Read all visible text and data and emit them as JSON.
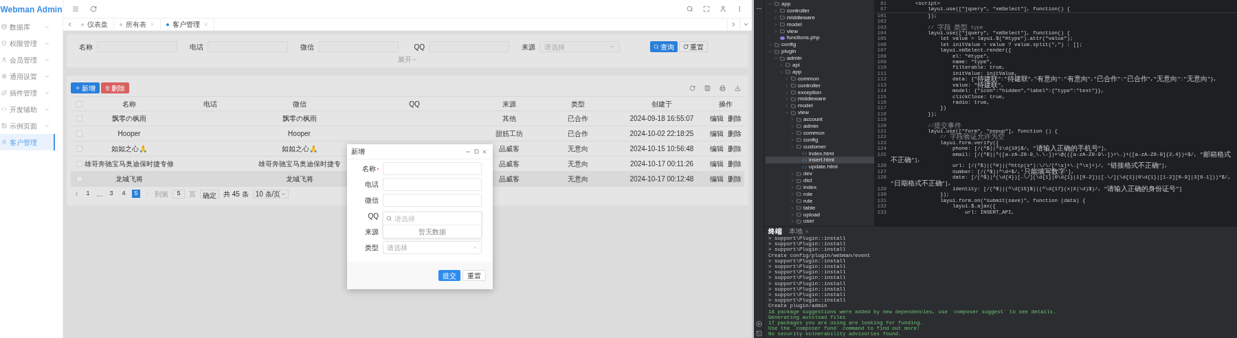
{
  "app": {
    "title": "Webman Admin"
  },
  "sidebar": {
    "items": [
      {
        "label": "数据库",
        "kind": "group",
        "selected": false
      },
      {
        "label": "权限管理",
        "kind": "group",
        "selected": false
      },
      {
        "label": "会员管理",
        "kind": "group",
        "selected": false
      },
      {
        "label": "通用设置",
        "kind": "group",
        "selected": false
      },
      {
        "label": "插件管理",
        "kind": "group",
        "selected": false
      },
      {
        "label": "开发辅助",
        "kind": "group",
        "selected": false
      },
      {
        "label": "示例页面",
        "kind": "group",
        "selected": false
      },
      {
        "label": "客户管理",
        "kind": "link",
        "selected": true
      }
    ]
  },
  "tabs": [
    {
      "label": "仪表盘",
      "selected": false,
      "closable": false
    },
    {
      "label": "所有表",
      "selected": false,
      "closable": true
    },
    {
      "label": "客户管理",
      "selected": true,
      "closable": true
    }
  ],
  "search_form": {
    "fields": [
      {
        "label": "名称",
        "kind": "input"
      },
      {
        "label": "电话",
        "kind": "input"
      },
      {
        "label": "微信",
        "kind": "input"
      },
      {
        "label": "QQ",
        "kind": "input"
      },
      {
        "label": "来源",
        "kind": "select",
        "placeholder": "请选择"
      }
    ],
    "buttons": [
      {
        "label": "查询",
        "kind": "primary"
      },
      {
        "label": "重置",
        "kind": "default"
      }
    ],
    "expand_link": "展开"
  },
  "toolbar": {
    "buttons": [
      {
        "label": "新增",
        "kind": "primary"
      },
      {
        "label": "删除",
        "kind": "danger"
      }
    ]
  },
  "table": {
    "all_checked": false,
    "columns": [
      "名称",
      "电话",
      "微信",
      "QQ",
      "来源",
      "类型",
      "创建于",
      "操作"
    ],
    "rows": [
      {
        "name": "飘零の枫雨",
        "wechat": "飘零の枫雨",
        "source": "其他",
        "type": "已合作",
        "created_at": "2024-09-18 16:55:07",
        "actions": [
          "编辑",
          "删除"
        ],
        "checked": false,
        "hovered": false
      },
      {
        "name": "Hooper",
        "wechat": "Hooper",
        "source": "甜筋工坊",
        "type": "已合作",
        "created_at": "2024-10-02 22:18:25",
        "actions": [
          "编辑",
          "删除"
        ],
        "checked": false,
        "hovered": false
      },
      {
        "name": "如如之心🙏",
        "wechat": "如如之心🙏",
        "source": "品威客",
        "type": "无意向",
        "created_at": "2024-10-15 10:56:48",
        "actions": [
          "编辑",
          "删除"
        ],
        "checked": false,
        "hovered": false
      },
      {
        "name": "雄哥奔驰宝马奥迪保时捷专修",
        "wechat": "雄哥奔驰宝马奥迪保时捷专",
        "source": "品威客",
        "type": "无意向",
        "created_at": "2024-10-17 00:11:26",
        "actions": [
          "编辑",
          "删除"
        ],
        "checked": false,
        "hovered": false
      },
      {
        "name": "龙城飞将",
        "wechat": "龙城飞将",
        "source": "品威客",
        "type": "无意向",
        "created_at": "2024-10-17 00:12:48",
        "actions": [
          "编辑",
          "删除"
        ],
        "checked": false,
        "hovered": true
      }
    ]
  },
  "pagination": {
    "pages": [
      {
        "label": "1",
        "kind": "page",
        "selected": false
      },
      {
        "label": "…",
        "kind": "ellipsis",
        "selected": false
      },
      {
        "label": "3",
        "kind": "page",
        "selected": false
      },
      {
        "label": "4",
        "kind": "page",
        "selected": false
      },
      {
        "label": "5",
        "kind": "page",
        "selected": true
      }
    ],
    "next_disabled": true,
    "goto_label": "到第",
    "goto_value": "5",
    "page_unit": "页",
    "confirm": "确定",
    "total": "共 45 条",
    "page_size": "10 条/页"
  },
  "dialog": {
    "title": "新增",
    "fields": [
      {
        "label": "名称",
        "kind": "input",
        "required": true
      },
      {
        "label": "电话",
        "kind": "input",
        "required": false
      },
      {
        "label": "微信",
        "kind": "input",
        "required": false
      },
      {
        "label": "QQ",
        "kind": "covered",
        "required": false
      },
      {
        "label": "来源",
        "kind": "covered",
        "required": false
      },
      {
        "label": "类型",
        "kind": "select",
        "required": false,
        "placeholder": "请选择",
        "expanded": true,
        "dropdown": {
          "search_placeholder": "请选择",
          "empty_text": "暂无数据"
        }
      }
    ],
    "buttons": [
      {
        "label": "提交",
        "kind": "primary"
      },
      {
        "label": "重置",
        "kind": "default"
      }
    ]
  },
  "ide": {
    "file_tree": [
      {
        "name": "app",
        "kind": "folder",
        "expanded": true,
        "selected": false,
        "children": [
          {
            "name": "controller",
            "kind": "folder",
            "expanded": false,
            "selected": false
          },
          {
            "name": "middleware",
            "kind": "folder",
            "expanded": false,
            "selected": false
          },
          {
            "name": "model",
            "kind": "folder",
            "expanded": false,
            "selected": false
          },
          {
            "name": "view",
            "kind": "folder",
            "expanded": false,
            "selected": false
          },
          {
            "name": "functions.php",
            "kind": "php",
            "selected": false
          }
        ]
      },
      {
        "name": "config",
        "kind": "folder",
        "expanded": false,
        "selected": false
      },
      {
        "name": "plugin",
        "kind": "folder",
        "expanded": true,
        "selected": false,
        "children": [
          {
            "name": "admin",
            "kind": "folder",
            "expanded": true,
            "selected": false,
            "children": [
              {
                "name": "api",
                "kind": "folder",
                "expanded": false,
                "selected": false
              },
              {
                "name": "app",
                "kind": "folder",
                "expanded": true,
                "selected": false,
                "children": [
                  {
                    "name": "common",
                    "kind": "folder",
                    "expanded": false,
                    "selected": false
                  },
                  {
                    "name": "controller",
                    "kind": "folder",
                    "expanded": false,
                    "selected": false
                  },
                  {
                    "name": "exception",
                    "kind": "folder",
                    "expanded": false,
                    "selected": false
                  },
                  {
                    "name": "middleware",
                    "kind": "folder",
                    "expanded": false,
                    "selected": false
                  },
                  {
                    "name": "model",
                    "kind": "folder",
                    "expanded": false,
                    "selected": false
                  },
                  {
                    "name": "view",
                    "kind": "folder",
                    "expanded": true,
                    "selected": false,
                    "children": [
                      {
                        "name": "account",
                        "kind": "folder",
                        "expanded": false,
                        "selected": false
                      },
                      {
                        "name": "admin",
                        "kind": "folder",
                        "expanded": false,
                        "selected": false
                      },
                      {
                        "name": "common",
                        "kind": "folder",
                        "expanded": false,
                        "selected": false
                      },
                      {
                        "name": "config",
                        "kind": "folder",
                        "expanded": false,
                        "selected": false
                      },
                      {
                        "name": "customer",
                        "kind": "folder",
                        "expanded": true,
                        "selected": false,
                        "children": [
                          {
                            "name": "index.html",
                            "kind": "html",
                            "selected": false
                          },
                          {
                            "name": "insert.html",
                            "kind": "html",
                            "selected": true
                          },
                          {
                            "name": "update.html",
                            "kind": "html",
                            "selected": false
                          }
                        ]
                      },
                      {
                        "name": "dev",
                        "kind": "folder",
                        "expanded": false,
                        "selected": false
                      },
                      {
                        "name": "dict",
                        "kind": "folder",
                        "expanded": false,
                        "selected": false
                      },
                      {
                        "name": "index",
                        "kind": "folder",
                        "expanded": false,
                        "selected": false
                      },
                      {
                        "name": "role",
                        "kind": "folder",
                        "expanded": false,
                        "selected": false
                      },
                      {
                        "name": "rule",
                        "kind": "folder",
                        "expanded": false,
                        "selected": false
                      },
                      {
                        "name": "table",
                        "kind": "folder",
                        "expanded": false,
                        "selected": false
                      },
                      {
                        "name": "upload",
                        "kind": "folder",
                        "expanded": false,
                        "selected": false
                      },
                      {
                        "name": "user",
                        "kind": "folder",
                        "expanded": false,
                        "selected": false
                      }
                    ]
                  }
                ]
              }
            ]
          }
        ]
      }
    ],
    "editor": {
      "sticky_lines": [
        {
          "number": "81",
          "text": "        <script>",
          "kind": "code"
        },
        {
          "number": "87",
          "text": "            layui.use([\"jquery\", \"xmSelect\"], function() {",
          "kind": "code"
        }
      ],
      "lines": [
        {
          "number": "101",
          "text": "            });",
          "kind": "code"
        },
        {
          "number": "102"
        },
        {
          "number": "103",
          "text": "            // 字段 类型 type",
          "kind": "comment"
        },
        {
          "number": "104",
          "text": "            layui.use([\"jquery\", \"xmSelect\"], function() {",
          "kind": "code"
        },
        {
          "number": "105",
          "text": "                let value = layui.$(\"#type\").attr(\"value\");",
          "kind": "code"
        },
        {
          "number": "106",
          "text": "                let initValue = value ? value.split(\",\") : [];",
          "kind": "code"
        },
        {
          "number": "107",
          "text": "                layui.xmSelect.render({",
          "kind": "code"
        },
        {
          "number": "108",
          "text": "                    el: \"#type\",",
          "kind": "code"
        },
        {
          "number": "109",
          "text": "                    name: \"type\",",
          "kind": "code"
        },
        {
          "number": "110",
          "text": "                    filterable: true,",
          "kind": "code"
        },
        {
          "number": "111",
          "text": "                    initValue: initValue,",
          "kind": "code"
        },
        {
          "number": "112",
          "text": "                    data: {\"待建联\":\"待建联\",\"有意向\":\"有意向\",\"已合作\":\"已合作\",\"无意向\":\"无意向\"},",
          "kind": "code"
        },
        {
          "number": "113",
          "text": "                    value: \"待建联\",",
          "kind": "code"
        },
        {
          "number": "114",
          "text": "                    model: {\"icon\":\"hidden\",\"label\":{\"type\":\"text\"}},",
          "kind": "code"
        },
        {
          "number": "115",
          "text": "                    clickClose: true,",
          "kind": "code"
        },
        {
          "number": "116",
          "text": "                    radio: true,",
          "kind": "code"
        },
        {
          "number": "117",
          "text": "                })",
          "kind": "code"
        },
        {
          "number": "118",
          "text": "            });",
          "kind": "code"
        },
        {
          "number": "119"
        },
        {
          "number": "120",
          "text": "            //提交事件",
          "kind": "comment"
        },
        {
          "number": "121",
          "text": "            layui.use([\"form\", \"popup\"], function () {",
          "kind": "code"
        },
        {
          "number": "122",
          "text": "                // 字段验证允许为空",
          "kind": "comment"
        },
        {
          "number": "123",
          "text": "                layui.form.verify({",
          "kind": "code"
        },
        {
          "number": "124",
          "text": "                    phone: [/(^$)|^1\\d{10}$/, \"请输入正确的手机号\"],",
          "kind": "code"
        },
        {
          "number": "125",
          "text": "                    email: [/(^$)|^([a-zA-Z0-9_\\.\\-])+\\@(([a-zA-Z0-9\\-])+\\.)+([a-zA-Z0-9]{2,4})+$/, \"邮箱格式不正确\"],",
          "kind": "code"
        },
        {
          "number": "126",
          "text": "                    url: [/(^$)|(^#)|(^http(s*):\\/\\/[^\\s]+\\.[^\\s]+)/, \"链接格式不正确\"],",
          "kind": "code"
        },
        {
          "number": "127",
          "text": "                    number: [/(^$)|^\\d+$/,'只能填写数字'],",
          "kind": "code"
        },
        {
          "number": "128",
          "text": "                    date: [/(^$)|^(\\d{4})[-\\/](\\d{1}|0\\d{1}|1[0-2])([-\\/](\\d{1}|0\\d{1}|[1-2][0-9]|3[0-1]))*$/, \"日期格式不正确\"],",
          "kind": "code"
        },
        {
          "number": "129",
          "text": "                    identity: [/(^$)|(^\\d{15}$)|(^\\d{17}(x|X|\\d)$)/, \"请输入正确的身份证号\"]",
          "kind": "code"
        },
        {
          "number": "130",
          "text": "                });",
          "kind": "code"
        },
        {
          "number": "131",
          "text": "                layui.form.on(\"submit(save)\", function (data) {",
          "kind": "code"
        },
        {
          "number": "132",
          "text": "                    layui.$.ajax({",
          "kind": "code"
        },
        {
          "number": "133",
          "text": "                        url: INSERT_API,",
          "kind": "code"
        }
      ]
    },
    "terminal": {
      "tabs": [
        {
          "label": "终端",
          "selected": true,
          "closable": false
        },
        {
          "label": "本地",
          "selected": false,
          "closable": true
        }
      ],
      "lines": [
        {
          "text": "> support\\Plugin::install",
          "kind": "output"
        },
        {
          "text": "> support\\Plugin::install",
          "kind": "output"
        },
        {
          "text": "> support\\Plugin::install",
          "kind": "output"
        },
        {
          "text": "Create config/plugin/webman/event",
          "kind": "output"
        },
        {
          "text": "> support\\Plugin::install",
          "kind": "output"
        },
        {
          "text": "> support\\Plugin::install",
          "kind": "output"
        },
        {
          "text": "> support\\Plugin::install",
          "kind": "output"
        },
        {
          "text": "> support\\Plugin::install",
          "kind": "output"
        },
        {
          "text": "> support\\Plugin::install",
          "kind": "output"
        },
        {
          "text": "> support\\Plugin::install",
          "kind": "output"
        },
        {
          "text": "> support\\Plugin::install",
          "kind": "output"
        },
        {
          "text": "> support\\Plugin::install",
          "kind": "output"
        },
        {
          "text": "Create plugin/admin",
          "kind": "output"
        },
        {
          "text": "18 package suggestions were added by new dependencies, use `composer suggest` to see details.",
          "kind": "success"
        },
        {
          "text": "Generating autoload files",
          "kind": "success"
        },
        {
          "text": "17 packages you are using are looking for funding.",
          "kind": "success"
        },
        {
          "text": "Use the `composer fund` command to find out more!",
          "kind": "success"
        },
        {
          "text": "No security vulnerability advisories found.",
          "kind": "success"
        }
      ]
    }
  }
}
